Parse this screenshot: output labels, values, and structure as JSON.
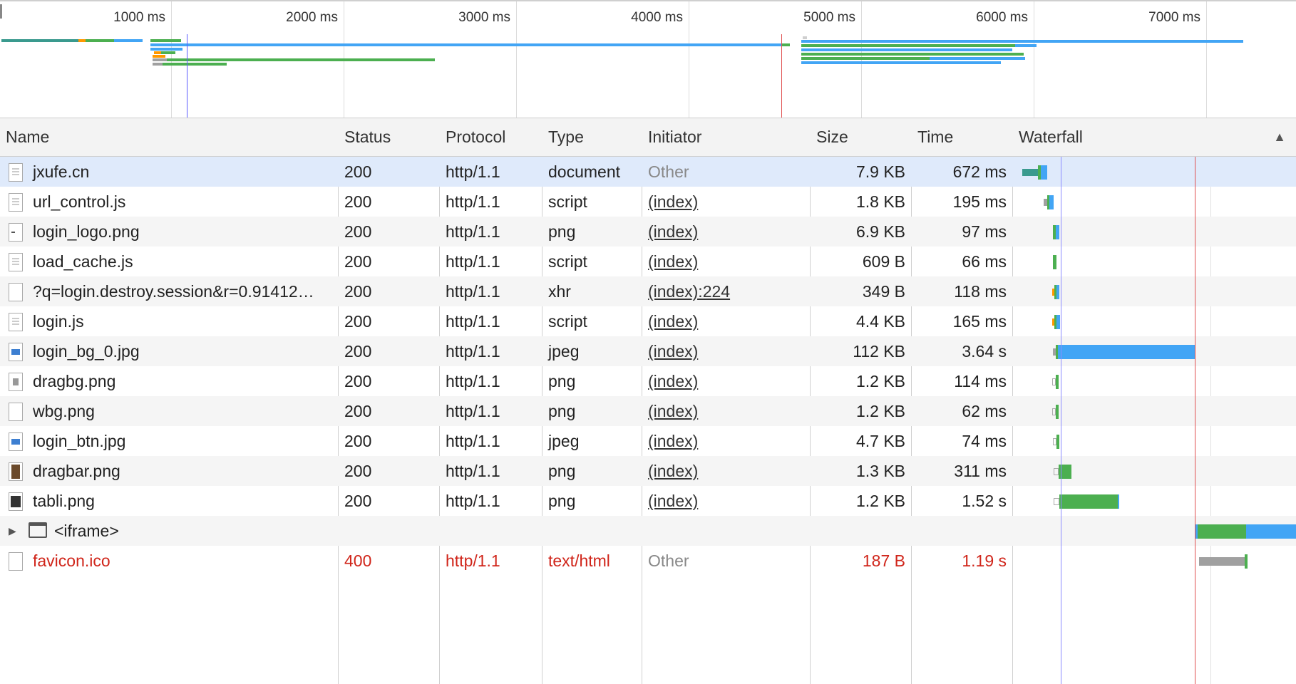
{
  "overview": {
    "ticks": [
      "1000 ms",
      "2000 ms",
      "3000 ms",
      "4000 ms",
      "5000 ms",
      "6000 ms",
      "7000 ms"
    ]
  },
  "columns": {
    "name": "Name",
    "status": "Status",
    "protocol": "Protocol",
    "type": "Type",
    "initiator": "Initiator",
    "size": "Size",
    "time": "Time",
    "waterfall": "Waterfall"
  },
  "rows": [
    {
      "name": "jxufe.cn",
      "status": "200",
      "protocol": "http/1.1",
      "type": "document",
      "initiator": "Other",
      "size": "7.9 KB",
      "time": "672 ms",
      "icon": "document-icon"
    },
    {
      "name": "url_control.js",
      "status": "200",
      "protocol": "http/1.1",
      "type": "script",
      "initiator": "(index)",
      "size": "1.8 KB",
      "time": "195 ms",
      "icon": "script-file-icon"
    },
    {
      "name": "login_logo.png",
      "status": "200",
      "protocol": "http/1.1",
      "type": "png",
      "initiator": "(index)",
      "size": "6.9 KB",
      "time": "97 ms",
      "icon": "image-file-icon"
    },
    {
      "name": "load_cache.js",
      "status": "200",
      "protocol": "http/1.1",
      "type": "script",
      "initiator": "(index)",
      "size": "609 B",
      "time": "66 ms",
      "icon": "script-file-icon"
    },
    {
      "name": "?q=login.destroy.session&r=0.91412…",
      "status": "200",
      "protocol": "http/1.1",
      "type": "xhr",
      "initiator": "(index):224",
      "size": "349 B",
      "time": "118 ms",
      "icon": "blank-file-icon"
    },
    {
      "name": "login.js",
      "status": "200",
      "protocol": "http/1.1",
      "type": "script",
      "initiator": "(index)",
      "size": "4.4 KB",
      "time": "165 ms",
      "icon": "script-file-icon"
    },
    {
      "name": "login_bg_0.jpg",
      "status": "200",
      "protocol": "http/1.1",
      "type": "jpeg",
      "initiator": "(index)",
      "size": "112 KB",
      "time": "3.64 s",
      "icon": "image-file-icon"
    },
    {
      "name": "dragbg.png",
      "status": "200",
      "protocol": "http/1.1",
      "type": "png",
      "initiator": "(index)",
      "size": "1.2 KB",
      "time": "114 ms",
      "icon": "image-file-icon"
    },
    {
      "name": "wbg.png",
      "status": "200",
      "protocol": "http/1.1",
      "type": "png",
      "initiator": "(index)",
      "size": "1.2 KB",
      "time": "62 ms",
      "icon": "blank-file-icon"
    },
    {
      "name": "login_btn.jpg",
      "status": "200",
      "protocol": "http/1.1",
      "type": "jpeg",
      "initiator": "(index)",
      "size": "4.7 KB",
      "time": "74 ms",
      "icon": "image-file-icon"
    },
    {
      "name": "dragbar.png",
      "status": "200",
      "protocol": "http/1.1",
      "type": "png",
      "initiator": "(index)",
      "size": "1.3 KB",
      "time": "311 ms",
      "icon": "image-file-icon"
    },
    {
      "name": "tabli.png",
      "status": "200",
      "protocol": "http/1.1",
      "type": "png",
      "initiator": "(index)",
      "size": "1.2 KB",
      "time": "1.52 s",
      "icon": "image-file-icon"
    },
    {
      "name": "<iframe>",
      "status": "",
      "protocol": "",
      "type": "",
      "initiator": "",
      "size": "",
      "time": "",
      "icon": "frame-icon"
    },
    {
      "name": "favicon.ico",
      "status": "400",
      "protocol": "http/1.1",
      "type": "text/html",
      "initiator": "Other",
      "size": "187 B",
      "time": "1.19 s",
      "icon": "blank-file-icon"
    }
  ],
  "colors": {
    "waiting": "#4caf50",
    "receiving": "#42a5f5",
    "blocked": "#a0a0a0",
    "connect": "#ff9800",
    "dom_content_loaded": "#5b5bff",
    "load": "#e05050",
    "error_text": "#d0251a"
  }
}
